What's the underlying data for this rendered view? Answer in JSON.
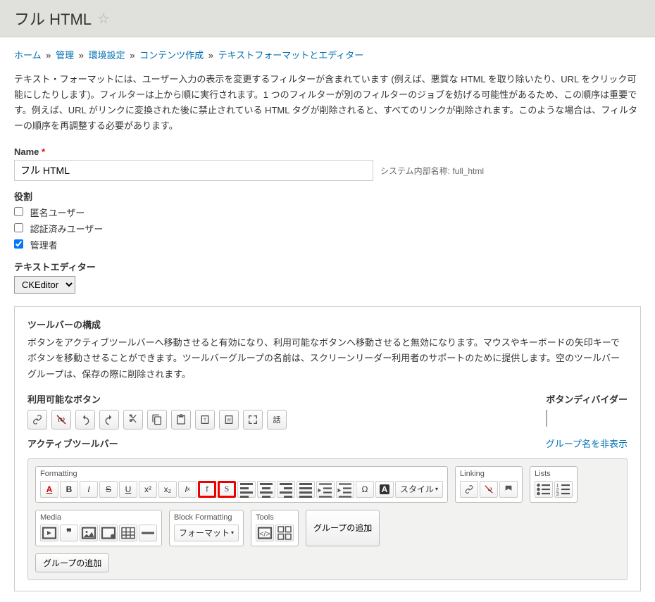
{
  "page": {
    "title": "フル HTML"
  },
  "breadcrumb": {
    "items": [
      "ホーム",
      "管理",
      "環境設定",
      "コンテンツ作成",
      "テキストフォーマットとエディター"
    ]
  },
  "intro": "テキスト・フォーマットには、ユーザー入力の表示を変更するフィルターが含まれています (例えば、悪質な HTML を取り除いたり、URL をクリック可能にしたりします)。フィルターは上から順に実行されます。1 つのフィルターが別のフィルターのジョブを妨げる可能性があるため、この順序は重要です。例えば、URL がリンクに変換された後に禁止されている HTML タグが削除されると、すべてのリンクが削除されます。このような場合は、フィルターの順序を再調整する必要があります。",
  "name": {
    "label": "Name",
    "value": "フル HTML",
    "machine_prefix": "システム内部名称:",
    "machine": "full_html"
  },
  "roles": {
    "label": "役割",
    "items": [
      {
        "label": "匿名ユーザー",
        "checked": false
      },
      {
        "label": "認証済みユーザー",
        "checked": false
      },
      {
        "label": "管理者",
        "checked": true
      }
    ]
  },
  "editor": {
    "label": "テキストエディター",
    "value": "CKEditor"
  },
  "toolbar_config": {
    "heading": "ツールバーの構成",
    "desc": "ボタンをアクティブツールバーへ移動させると有効になり、利用可能なボタンへ移動させると無効になります。マウスやキーボードの矢印キーでボタンを移動させることができます。ツールバーグループの名前は、スクリーンリーダー利用者のサポートのために提供します。空のツールバーグループは、保存の際に削除されます。"
  },
  "available": {
    "label": "利用可能なボタン",
    "buttons": [
      "link",
      "unlink",
      "undo",
      "redo",
      "cut",
      "copy",
      "paste",
      "paste-text",
      "paste-word",
      "maximize",
      "language-dialog"
    ]
  },
  "divider": {
    "label": "ボタンディバイダー"
  },
  "active": {
    "label": "アクティブツールバー",
    "hide_names": "グループ名を非表示",
    "add_group": "グループの追加"
  },
  "groups": {
    "formatting": {
      "label": "Formatting",
      "style_label": "スタイル"
    },
    "linking": {
      "label": "Linking"
    },
    "lists": {
      "label": "Lists"
    },
    "media": {
      "label": "Media"
    },
    "block": {
      "label": "Block Formatting",
      "format_label": "フォーマット"
    },
    "tools": {
      "label": "Tools"
    }
  }
}
